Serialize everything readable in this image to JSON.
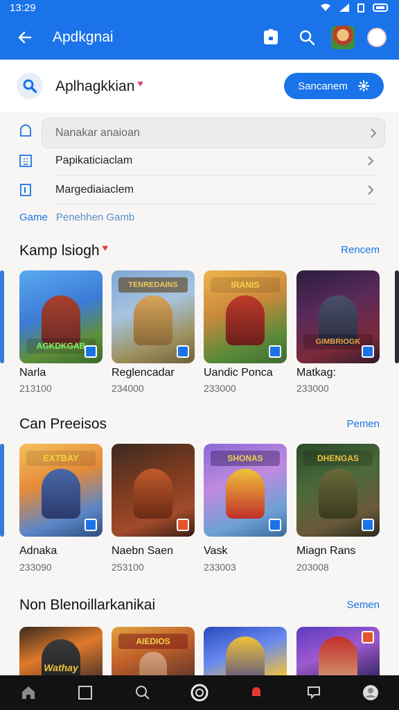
{
  "status": {
    "time": "13:29"
  },
  "appbar": {
    "title": "Apdkgnai"
  },
  "search": {
    "title": "Aplhagkkian",
    "button_label": "Sancanem"
  },
  "menu": {
    "field_placeholder": "Nanakar anaioan",
    "row2_label": "Papikaticiaclam",
    "row3_label": "Margediaiaclem"
  },
  "tagline": {
    "key": "Game",
    "value": "Penehhen Gamb"
  },
  "sections": [
    {
      "title": "Kamp lsiogh",
      "link": "Rencem",
      "items": [
        {
          "name": "Narla",
          "meta": "213100",
          "logo": "AGKDKGAB"
        },
        {
          "name": "Reglencadar",
          "meta": "234000",
          "logo": "TENREDAINS"
        },
        {
          "name": "Uandic Ponca",
          "meta": "233000",
          "logo": "IRANIS"
        },
        {
          "name": "Matkag:",
          "meta": "233000",
          "logo": "GIMBRIOGK"
        }
      ]
    },
    {
      "title": "Can Preeisos",
      "link": "Pemen",
      "items": [
        {
          "name": "Adnaka",
          "meta": "233090",
          "logo": "EXTBAY"
        },
        {
          "name": "Naebn Saen",
          "meta": "253100",
          "logo": ""
        },
        {
          "name": "Vask",
          "meta": "233003",
          "logo": "SHONAS"
        },
        {
          "name": "Miagn Rans",
          "meta": "203008",
          "logo": "DHENGAS"
        }
      ]
    },
    {
      "title": "Non Blenoillarkanikai",
      "link": "Semen",
      "items": [
        {
          "name": "",
          "meta": "",
          "logo": "Wathay"
        },
        {
          "name": "",
          "meta": "",
          "logo": "AIEDIOS"
        },
        {
          "name": "",
          "meta": "",
          "logo": ""
        },
        {
          "name": "",
          "meta": "",
          "logo": ""
        }
      ]
    }
  ],
  "colors": {
    "primary": "#1a73e8",
    "heart": "#e0457b"
  }
}
